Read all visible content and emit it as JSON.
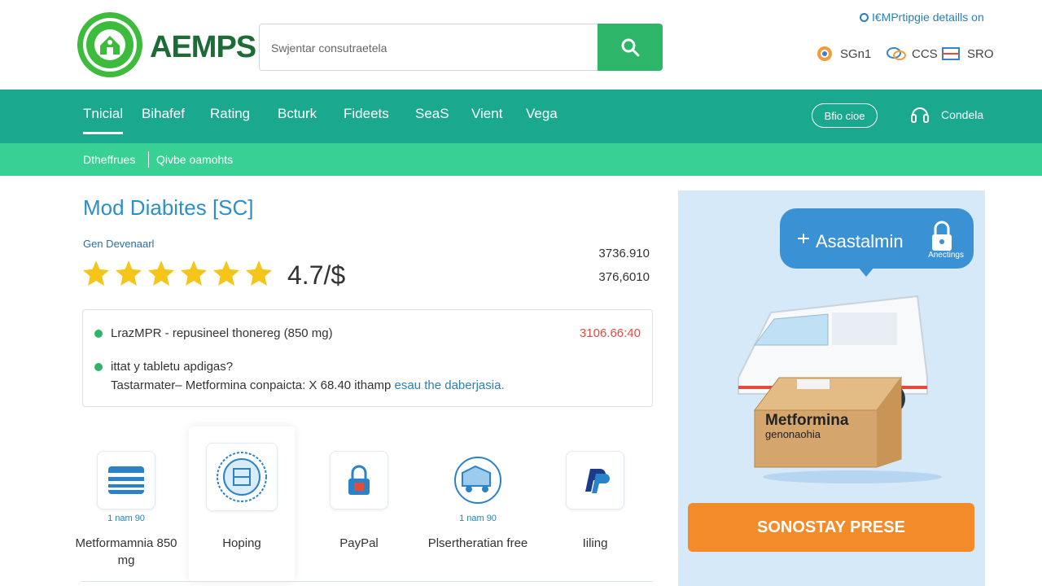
{
  "header": {
    "brand": "AEMPS",
    "search": {
      "placeholder": "Swjentar consutraetela"
    },
    "top_link": "I€MPrtipgie detaills on",
    "utilities": [
      {
        "label": "SGn1",
        "icon": "medal-icon"
      },
      {
        "label": "CCS",
        "icon": "chat-icon"
      },
      {
        "label": "SRO",
        "icon": "flag-icon"
      }
    ]
  },
  "nav": {
    "items": [
      "Tnicial",
      "Bihafef",
      "Rating",
      "Bcturk",
      "Fideets",
      "SeaS",
      "Vient",
      "Vega"
    ],
    "pill": "Bfio cioe",
    "help": "Condela"
  },
  "subnav": {
    "items": [
      "Dtheffrues",
      "Qivbe oamohts"
    ]
  },
  "product": {
    "title": "Mod Diabites [SC]",
    "subtitle": "Gen Devenaarl",
    "rating": "4.7/$",
    "rating_value": 5,
    "price_a": "3736.910",
    "price_b": "376,6010",
    "info": {
      "line1": "LrazMPR - repusineel thonereg (850 mg)",
      "line1_price": "3106.66:40",
      "line2": "ittat y tabletu apdigas?",
      "line3_text": "Tastarmater– Metformina conpaicta: X 68.40 ithamp ",
      "line3_link": "esau the daberjasia."
    }
  },
  "cards": [
    {
      "sub": "1 nam 90",
      "label": "Metformamnia 850 mg",
      "icon": "card-icon"
    },
    {
      "sub": "",
      "label": "Hoping",
      "icon": "certificate-icon"
    },
    {
      "sub": "",
      "label": "PayPal",
      "icon": "lock-icon"
    },
    {
      "sub": "1 nam 90",
      "label": "Plsertheratian free",
      "icon": "shipping-icon"
    },
    {
      "sub": "",
      "label": "Iiling",
      "icon": "paypal-icon"
    }
  ],
  "ad": {
    "bubble_text": "Asastalmin",
    "bubble_sub": "Anectings",
    "box_label": "Metformina",
    "box_sub": "genonaohia",
    "cta": "SONOSTAY PRESE"
  },
  "colors": {
    "nav": "#1aa88e",
    "subnav": "#38d093",
    "search_button": "#2db56a",
    "cta": "#f38b2b",
    "ad_background": "#d6e9f9",
    "title": "#2b8fc9",
    "star": "#f5c518"
  }
}
